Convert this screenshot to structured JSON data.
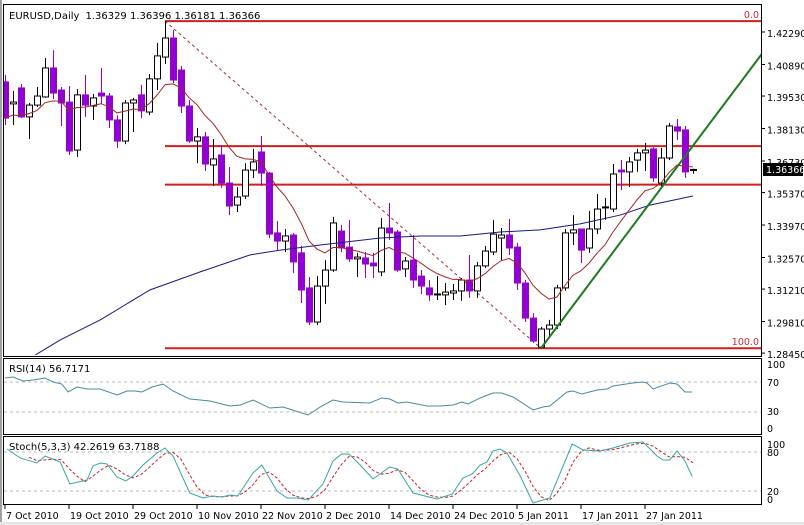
{
  "header": {
    "symbol": "EURUSD,Daily",
    "ohlc": "1.36329 1.36396 1.36181 1.36366"
  },
  "current_price_label": "1.36366",
  "indicators": {
    "rsi_caption": "RSI(14) 56.7171",
    "stoch_caption": "Stoch(5,3,3) 42.2619 63.7188",
    "rsi_levels": [
      "100",
      "70",
      "30",
      "0"
    ],
    "stoch_levels": [
      "100",
      "80",
      "20",
      "0"
    ]
  },
  "colors": {
    "bear": "#9400d3",
    "bull": "#ffffff",
    "outline": "#000000",
    "fib": "#cc2020",
    "fib_diag": "#a03030",
    "trend": "#1e7a1e",
    "ma_short": "#a02828",
    "ma_long": "#1a1a78",
    "rsi": "#4a8a9c",
    "stoch_main": "#3aa4a4",
    "stoch_signal": "#cc2020",
    "level": "#b8b8b8"
  },
  "chart_data": {
    "type": "candlestick",
    "title": "EURUSD,Daily",
    "ylim": [
      1.2845,
      1.4229
    ],
    "price_ticks": [
      "1.42290",
      "1.40890",
      "1.39530",
      "1.38130",
      "1.36730",
      "1.35370",
      "1.33970",
      "1.32570",
      "1.31210",
      "1.29810",
      "1.28450"
    ],
    "date_labels": [
      {
        "bar": 0,
        "label": "7 Oct 2010"
      },
      {
        "bar": 8,
        "label": "19 Oct 2010"
      },
      {
        "bar": 16,
        "label": "29 Oct 2010"
      },
      {
        "bar": 24,
        "label": "10 Nov 2010"
      },
      {
        "bar": 32,
        "label": "22 Nov 2010"
      },
      {
        "bar": 40,
        "label": "2 Dec 2010"
      },
      {
        "bar": 48,
        "label": "14 Dec 2010"
      },
      {
        "bar": 56,
        "label": "24 Dec 2010"
      },
      {
        "bar": 64,
        "label": "5 Jan 2011"
      },
      {
        "bar": 72,
        "label": "17 Jan 2011"
      },
      {
        "bar": 80,
        "label": "27 Jan 2011"
      }
    ],
    "candles_ohlc": [
      [
        1.4014,
        1.4044,
        1.3828,
        1.3858
      ],
      [
        1.3919,
        1.3975,
        1.3828,
        1.3927
      ],
      [
        1.3988,
        1.4005,
        1.3858,
        1.3863
      ],
      [
        1.3863,
        1.3923,
        1.3768,
        1.3914
      ],
      [
        1.3914,
        1.3992,
        1.3906,
        1.3953
      ],
      [
        1.3949,
        1.4117,
        1.3945,
        1.4074
      ],
      [
        1.4074,
        1.4151,
        1.394,
        1.3966
      ],
      [
        1.3979,
        1.3992,
        1.3824,
        1.3923
      ],
      [
        1.3927,
        1.3996,
        1.3699,
        1.3716
      ],
      [
        1.372,
        1.3983,
        1.369,
        1.3958
      ],
      [
        1.3958,
        1.4044,
        1.3863,
        1.3914
      ],
      [
        1.391,
        1.3962,
        1.385,
        1.3945
      ],
      [
        1.3966,
        1.4074,
        1.3919,
        1.3953
      ],
      [
        1.3953,
        1.3966,
        1.3815,
        1.385
      ],
      [
        1.385,
        1.3871,
        1.3729,
        1.3759
      ],
      [
        1.3759,
        1.3936,
        1.3746,
        1.3923
      ],
      [
        1.3923,
        1.3945,
        1.3798,
        1.3936
      ],
      [
        1.3958,
        1.4001,
        1.3858,
        1.3889
      ],
      [
        1.3884,
        1.4048,
        1.3871,
        1.4027
      ],
      [
        1.4027,
        1.4182,
        1.3979,
        1.4126
      ],
      [
        1.4121,
        1.4276,
        1.4091,
        1.4203
      ],
      [
        1.4203,
        1.4238,
        1.4009,
        1.4022
      ],
      [
        1.4065,
        1.4083,
        1.388,
        1.391
      ],
      [
        1.391,
        1.3936,
        1.3751,
        1.3759
      ],
      [
        1.3759,
        1.3815,
        1.3664,
        1.3777
      ],
      [
        1.3777,
        1.3798,
        1.363,
        1.366
      ],
      [
        1.3656,
        1.3768,
        1.3565,
        1.3682
      ],
      [
        1.3699,
        1.3742,
        1.3557,
        1.3578
      ],
      [
        1.3578,
        1.3647,
        1.344,
        1.3479
      ],
      [
        1.3483,
        1.3561,
        1.3453,
        1.3518
      ],
      [
        1.3522,
        1.3664,
        1.3509,
        1.3634
      ],
      [
        1.3634,
        1.3725,
        1.36,
        1.3669
      ],
      [
        1.3712,
        1.3781,
        1.3565,
        1.3621
      ],
      [
        1.3621,
        1.3626,
        1.3341,
        1.3358
      ],
      [
        1.3363,
        1.3414,
        1.3289,
        1.3328
      ],
      [
        1.3328,
        1.338,
        1.3281,
        1.335
      ],
      [
        1.3354,
        1.3363,
        1.319,
        1.3238
      ],
      [
        1.3277,
        1.3307,
        1.3061,
        1.3117
      ],
      [
        1.3126,
        1.3173,
        1.2966,
        1.2979
      ],
      [
        1.2979,
        1.3177,
        1.2966,
        1.3134
      ],
      [
        1.3134,
        1.3246,
        1.3057,
        1.3203
      ],
      [
        1.3203,
        1.3432,
        1.3195,
        1.3406
      ],
      [
        1.3371,
        1.3397,
        1.3281,
        1.3298
      ],
      [
        1.3302,
        1.3419,
        1.3238,
        1.3251
      ],
      [
        1.3251,
        1.3277,
        1.3173,
        1.3259
      ],
      [
        1.3255,
        1.3281,
        1.3169,
        1.3229
      ],
      [
        1.3233,
        1.3277,
        1.3169,
        1.3221
      ],
      [
        1.3195,
        1.3427,
        1.3177,
        1.3384
      ],
      [
        1.3384,
        1.3492,
        1.3333,
        1.3363
      ],
      [
        1.3367,
        1.3376,
        1.3195,
        1.3203
      ],
      [
        1.3208,
        1.3259,
        1.3173,
        1.3242
      ],
      [
        1.3246,
        1.3354,
        1.3126,
        1.316
      ],
      [
        1.3177,
        1.3203,
        1.31,
        1.3134
      ],
      [
        1.3126,
        1.316,
        1.307,
        1.3096
      ],
      [
        1.3096,
        1.3177,
        1.3074,
        1.31
      ],
      [
        1.3096,
        1.3147,
        1.3052,
        1.3108
      ],
      [
        1.3104,
        1.3143,
        1.3074,
        1.3113
      ],
      [
        1.3113,
        1.3169,
        1.307,
        1.316
      ],
      [
        1.316,
        1.3268,
        1.3083,
        1.3113
      ],
      [
        1.3113,
        1.3238,
        1.3083,
        1.3221
      ],
      [
        1.3221,
        1.3307,
        1.3212,
        1.3285
      ],
      [
        1.3281,
        1.3419,
        1.3268,
        1.3358
      ],
      [
        1.3341,
        1.3384,
        1.3246,
        1.3354
      ],
      [
        1.3354,
        1.3423,
        1.3268,
        1.3298
      ],
      [
        1.3302,
        1.332,
        1.3117,
        1.3147
      ],
      [
        1.3147,
        1.316,
        1.2979,
        1.2996
      ],
      [
        1.2996,
        1.3018,
        1.2889,
        1.2897
      ],
      [
        1.2871,
        1.2958,
        1.2863,
        1.2949
      ],
      [
        1.2949,
        1.2988,
        1.2915,
        1.2966
      ],
      [
        1.2966,
        1.3139,
        1.2949,
        1.3126
      ],
      [
        1.3126,
        1.338,
        1.3113,
        1.3363
      ],
      [
        1.3363,
        1.344,
        1.3311,
        1.3376
      ],
      [
        1.338,
        1.338,
        1.3233,
        1.3289
      ],
      [
        1.3298,
        1.3458,
        1.3277,
        1.338
      ],
      [
        1.338,
        1.3531,
        1.3358,
        1.3466
      ],
      [
        1.3471,
        1.3514,
        1.3419,
        1.3475
      ],
      [
        1.3466,
        1.366,
        1.3453,
        1.3617
      ],
      [
        1.3634,
        1.3677,
        1.3548,
        1.3626
      ],
      [
        1.3626,
        1.369,
        1.3561,
        1.3669
      ],
      [
        1.3677,
        1.3725,
        1.3626,
        1.3708
      ],
      [
        1.3708,
        1.3751,
        1.363,
        1.372
      ],
      [
        1.3725,
        1.3733,
        1.3583,
        1.36
      ],
      [
        1.3578,
        1.3729,
        1.3557,
        1.3686
      ],
      [
        1.3686,
        1.3837,
        1.3677,
        1.3824
      ],
      [
        1.382,
        1.3854,
        1.3764,
        1.3802
      ],
      [
        1.3807,
        1.3824,
        1.36,
        1.3626
      ],
      [
        1.36329,
        1.36396,
        1.36181,
        1.36366
      ]
    ],
    "ma_long_points": [
      [
        3.8,
        1.2837
      ],
      [
        6.9,
        1.2902
      ],
      [
        11.9,
        1.2988
      ],
      [
        18.1,
        1.3117
      ],
      [
        24.4,
        1.3195
      ],
      [
        30.6,
        1.3268
      ],
      [
        34.4,
        1.3289
      ],
      [
        39.4,
        1.3311
      ],
      [
        46.9,
        1.3341
      ],
      [
        51.9,
        1.335
      ],
      [
        56.9,
        1.335
      ],
      [
        61.9,
        1.3367
      ],
      [
        66.9,
        1.3376
      ],
      [
        71.9,
        1.3402
      ],
      [
        76.9,
        1.344
      ],
      [
        80.6,
        1.3483
      ],
      [
        86,
        1.3522
      ]
    ],
    "ma_short_period": 10,
    "fibonacci": {
      "start_bar": 20,
      "end_bar": 67,
      "high": 1.4276,
      "low": 1.2866,
      "levels": [
        {
          "ratio": 0,
          "label": "0.0"
        },
        {
          "ratio": 0.382,
          "label": ""
        },
        {
          "ratio": 0.5,
          "label": ""
        },
        {
          "ratio": 1,
          "label": "100.0"
        }
      ]
    },
    "trendline": [
      [
        67,
        1.2866
      ],
      [
        87,
        1.3785
      ]
    ],
    "rsi": {
      "period": 14,
      "ylim": [
        0,
        100
      ],
      "levels": [
        30,
        70
      ],
      "points": [
        [
          0,
          75.3
        ],
        [
          1,
          76.7
        ],
        [
          2.25,
          71.3
        ],
        [
          3.5,
          72.7
        ],
        [
          5,
          75.3
        ],
        [
          6,
          70
        ],
        [
          7.1,
          67.3
        ],
        [
          7.9,
          56.7
        ],
        [
          9,
          63.3
        ],
        [
          10.25,
          60.7
        ],
        [
          11.9,
          60.7
        ],
        [
          14,
          52.7
        ],
        [
          15.25,
          58
        ],
        [
          16.25,
          58
        ],
        [
          17.1,
          56.7
        ],
        [
          18.4,
          63.3
        ],
        [
          19.75,
          67.3
        ],
        [
          21,
          58
        ],
        [
          23.1,
          47.3
        ],
        [
          24.4,
          46
        ],
        [
          25.6,
          44.7
        ],
        [
          28.1,
          38
        ],
        [
          29.4,
          39.3
        ],
        [
          31,
          46
        ],
        [
          33.1,
          35.3
        ],
        [
          34.75,
          36.7
        ],
        [
          37.9,
          26
        ],
        [
          39.4,
          36.7
        ],
        [
          41,
          46
        ],
        [
          42.25,
          43.3
        ],
        [
          45.6,
          42
        ],
        [
          47.1,
          48.7
        ],
        [
          48.1,
          47.3
        ],
        [
          49.1,
          42
        ],
        [
          50.25,
          43.3
        ],
        [
          52.75,
          38
        ],
        [
          54.4,
          38
        ],
        [
          56,
          39.3
        ],
        [
          57.1,
          43.3
        ],
        [
          57.9,
          40.7
        ],
        [
          59.4,
          48.7
        ],
        [
          61,
          55.3
        ],
        [
          62.1,
          55.3
        ],
        [
          63.5,
          50
        ],
        [
          66,
          32.7
        ],
        [
          67.25,
          36.7
        ],
        [
          68.1,
          38
        ],
        [
          70.25,
          56.7
        ],
        [
          71,
          58
        ],
        [
          72.1,
          54
        ],
        [
          74,
          59.3
        ],
        [
          75.25,
          60.7
        ],
        [
          76,
          64.7
        ],
        [
          78.5,
          68.7
        ],
        [
          79.75,
          70
        ],
        [
          80.25,
          68.7
        ],
        [
          81,
          60.7
        ],
        [
          83.1,
          68.7
        ],
        [
          84,
          67.3
        ],
        [
          85,
          56.7
        ],
        [
          85.9,
          56.7
        ]
      ]
    },
    "stochastic": {
      "params": "5,3,3",
      "ylim": [
        0,
        100
      ],
      "levels": [
        20,
        80
      ],
      "signal_period": 3,
      "main_points": [
        [
          0.25,
          84.6
        ],
        [
          1.9,
          70.8
        ],
        [
          4,
          63.1
        ],
        [
          5,
          73.8
        ],
        [
          6.9,
          64.6
        ],
        [
          8.1,
          30.8
        ],
        [
          10.25,
          36.9
        ],
        [
          11,
          58.5
        ],
        [
          11.9,
          63.1
        ],
        [
          12.75,
          61.5
        ],
        [
          14,
          41.5
        ],
        [
          15.1,
          35.4
        ],
        [
          16,
          43.1
        ],
        [
          17.25,
          60
        ],
        [
          19,
          78.5
        ],
        [
          20,
          86.2
        ],
        [
          21,
          73.8
        ],
        [
          23.1,
          16.9
        ],
        [
          24.75,
          9.2
        ],
        [
          26,
          12.3
        ],
        [
          27.1,
          10.8
        ],
        [
          28.1,
          13.8
        ],
        [
          29.1,
          12.3
        ],
        [
          31,
          47.7
        ],
        [
          32.1,
          60
        ],
        [
          34,
          20
        ],
        [
          35.25,
          9.2
        ],
        [
          36.5,
          9.2
        ],
        [
          37.9,
          6.2
        ],
        [
          39.75,
          30.8
        ],
        [
          41,
          66.2
        ],
        [
          42.1,
          76.9
        ],
        [
          43,
          76.9
        ],
        [
          44.4,
          60
        ],
        [
          46,
          38.5
        ],
        [
          48.1,
          56.9
        ],
        [
          49.1,
          53.8
        ],
        [
          51,
          16.9
        ],
        [
          54,
          7.7
        ],
        [
          55.9,
          15.4
        ],
        [
          57.25,
          40
        ],
        [
          58.4,
          46.2
        ],
        [
          59.4,
          60
        ],
        [
          60.25,
          64.6
        ],
        [
          61,
          81.5
        ],
        [
          61.9,
          84.6
        ],
        [
          62.75,
          78.5
        ],
        [
          64.4,
          43.1
        ],
        [
          66,
          1.5
        ],
        [
          68.1,
          9.2
        ],
        [
          70.9,
          92.3
        ],
        [
          72.25,
          83.1
        ],
        [
          74.4,
          81.5
        ],
        [
          76,
          86.2
        ],
        [
          78.1,
          93.8
        ],
        [
          79.75,
          95.4
        ],
        [
          81.5,
          73.8
        ],
        [
          82.25,
          67.7
        ],
        [
          83.1,
          67.7
        ],
        [
          84,
          81.5
        ],
        [
          85,
          66.2
        ],
        [
          85.9,
          42.3
        ]
      ]
    }
  }
}
